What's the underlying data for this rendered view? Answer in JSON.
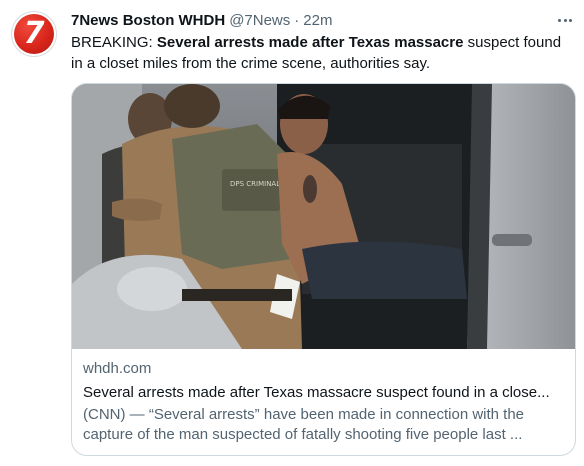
{
  "tweet": {
    "avatar_text": "7",
    "display_name": "7News Boston WHDH",
    "handle": "@7News",
    "separator": "·",
    "time": "22m",
    "text_prefix": "BREAKING: ",
    "text_bold": "Several arrests made after Texas massacre",
    "text_rest": " suspect found in a closet miles from the crime scene, authorities say.",
    "more_icon": "more-dots-icon"
  },
  "card": {
    "domain": "whdh.com",
    "title": "Several arrests made after Texas massacre suspect found in a close...",
    "description": "(CNN) — “Several arrests” have been made in connection with the capture of the man suspected of fatally shooting five people last ...",
    "vest_text": "DPS CRIMINAL INVESTIGATIONS"
  },
  "colors": {
    "text": "#0f1419",
    "secondary": "#536471",
    "border": "#cfd9de",
    "brand_red": "#d9261c"
  }
}
